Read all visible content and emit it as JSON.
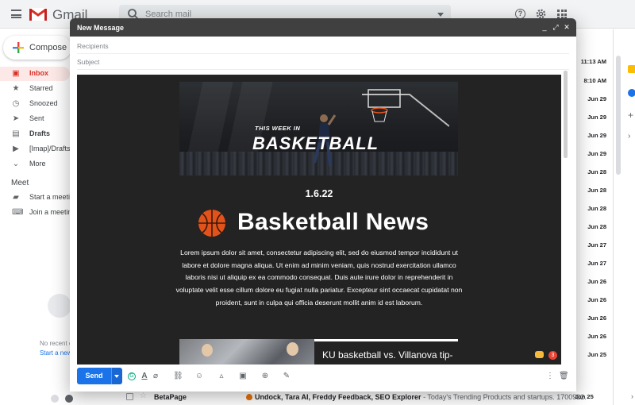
{
  "app": {
    "name": "Gmail",
    "search_placeholder": "Search mail",
    "compose_label": "Compose"
  },
  "sidebar": {
    "items": [
      {
        "label": "Inbox",
        "icon": "inbox-icon"
      },
      {
        "label": "Starred",
        "icon": "star-icon"
      },
      {
        "label": "Snoozed",
        "icon": "clock-icon"
      },
      {
        "label": "Sent",
        "icon": "send-icon"
      },
      {
        "label": "Drafts",
        "icon": "draft-icon"
      },
      {
        "label": "[Imap]/Drafts",
        "icon": "label-icon"
      },
      {
        "label": "More",
        "icon": "chevron-down-icon"
      }
    ],
    "meet": {
      "heading": "Meet",
      "items": [
        {
          "label": "Start a meeting",
          "icon": "video-icon"
        },
        {
          "label": "Join a meeting",
          "icon": "keyboard-icon"
        }
      ]
    },
    "hangouts": {
      "no_recent": "No recent c",
      "start_new": "Start a new"
    }
  },
  "mail_list": {
    "dates": [
      "11:13 AM",
      "8:10 AM",
      "Jun 29",
      "Jun 29",
      "Jun 29",
      "Jun 29",
      "Jun 28",
      "Jun 28",
      "Jun 28",
      "Jun 28",
      "Jun 27",
      "Jun 27",
      "Jun 26",
      "Jun 26",
      "Jun 26",
      "Jun 26",
      "Jun 25",
      "Jun 25"
    ],
    "bottom_row": {
      "sender": "BetaPage",
      "subject": "Undock, Tara AI, Freddy Feedback, SEO Explorer",
      "snippet": " - Today's Trending Products and startups. 1700922...",
      "date": "Jun 25"
    }
  },
  "compose": {
    "title": "New Message",
    "recipients_placeholder": "Recipients",
    "subject_placeholder": "Subject",
    "send_label": "Send",
    "badge_count": "3",
    "email": {
      "banner_subtitle": "THIS WEEK IN",
      "banner_title": "BASKETBALL",
      "date": "1.6.22",
      "heading": "Basketball News",
      "paragraph": "Lorem ipsum dolor sit amet, consectetur adipiscing elit, sed do eiusmod tempor incididunt ut labore et dolore magna aliqua. Ut enim ad minim veniam, quis nostrud exercitation ullamco laboris nisi ut aliquip ex ea commodo consequat. Duis aute irure dolor in reprehenderit in voluptate velit esse cillum dolore eu fugiat nulla pariatur. Excepteur sint occaecat cupidatat non proident, sunt in culpa qui officia deserunt mollit anim id est laborum.",
      "card_title": "KU basketball vs. Villanova tip-"
    },
    "toolbar_icons": [
      "formatting-icon",
      "attach-icon",
      "link-icon",
      "emoji-icon",
      "drive-icon",
      "photo-icon",
      "lock-clock-icon",
      "signature-icon",
      "more-options-icon",
      "trash-icon"
    ]
  },
  "colors": {
    "brand_red": "#d93025",
    "send_blue": "#1a73e8",
    "compose_header": "#404040",
    "email_bg": "#232323",
    "basketball_orange": "#e2531b"
  }
}
